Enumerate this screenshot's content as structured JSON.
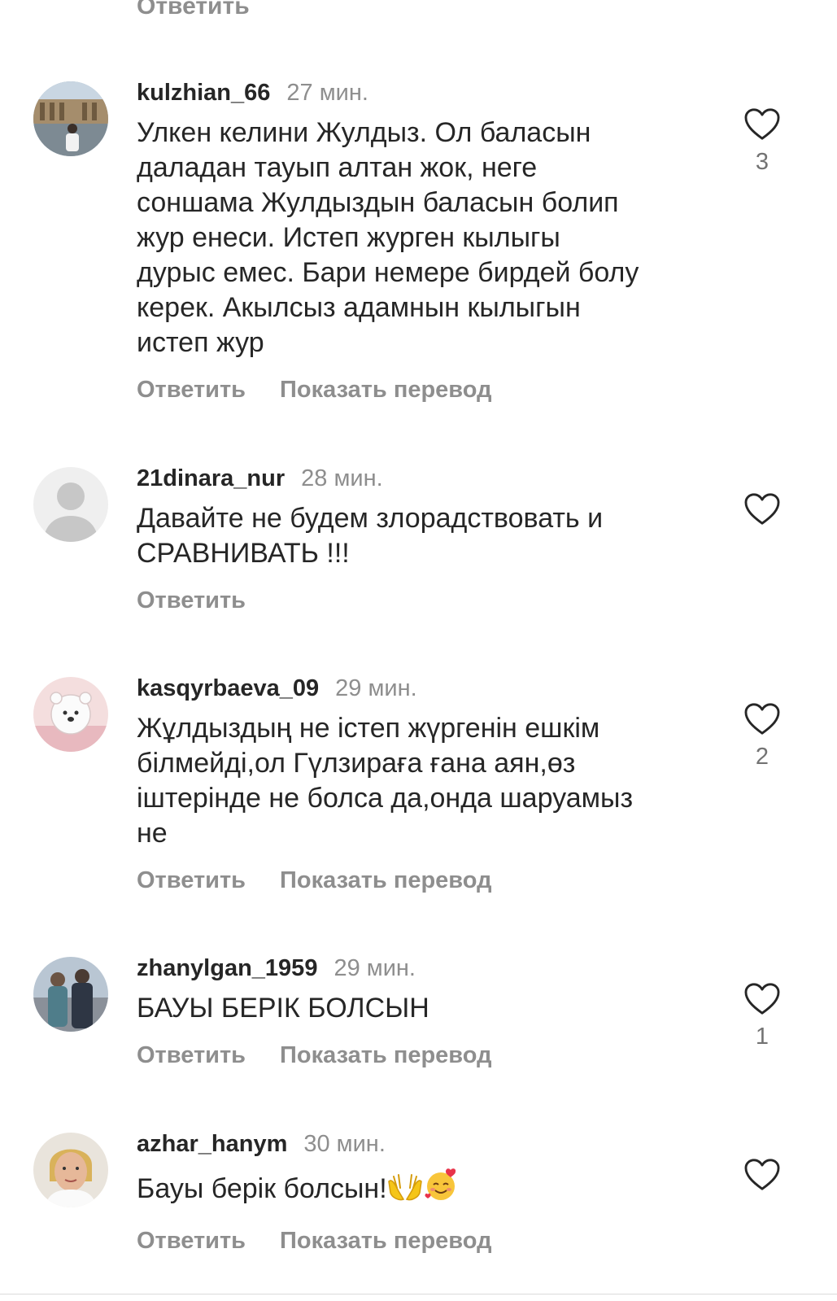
{
  "top": {
    "reply_label": "Ответить"
  },
  "comments": [
    {
      "username": "kulzhian_66",
      "time": "27 мин.",
      "text": "Улкен келини Жулдыз. Ол баласын\nдаладан тауып алтан жок, неге\nсоншама Жулдыздын баласын болип\nжур енеси. Истеп журген кылыгы\nдурыс емес. Бари немере бирдей болу\nкерек. Акылсыз адамнын кылыгын\nистеп жур",
      "reply": "Ответить",
      "translate": "Показать перевод",
      "likes": "3"
    },
    {
      "username": "21dinara_nur",
      "time": "28 мин.",
      "text": "Давайте не будем злорадствовать и\nСРАВНИВАТЬ !!!",
      "reply": "Ответить",
      "likes": ""
    },
    {
      "username": "kasqyrbaeva_09",
      "time": "29 мин.",
      "text": "Жұлдыздың не істеп жүргенін ешкім\nбілмейді,ол Гүлзираға ғана аян,өз\nіштерінде не болса да,онда шаруамыз\nне",
      "reply": "Ответить",
      "translate": "Показать перевод",
      "likes": "2"
    },
    {
      "username": "zhanylgan_1959",
      "time": "29 мин.",
      "text": "БАУЫ БЕРІК БОЛСЫН",
      "reply": "Ответить",
      "translate": "Показать перевод",
      "likes": "1"
    },
    {
      "username": "azhar_hanym",
      "time": "30 мин.",
      "text": "Бауы берік болсын!",
      "emoji": [
        "palms-up-together-emoji",
        "smiling-face-with-hearts-emoji"
      ],
      "reply": "Ответить",
      "translate": "Показать перевод",
      "likes": ""
    }
  ],
  "colors": {
    "text": "#262626",
    "secondary": "#8e8e8e",
    "background": "#ffffff"
  },
  "icons": {
    "like": "heart-outline-icon",
    "default_avatar": "default-avatar-icon"
  }
}
